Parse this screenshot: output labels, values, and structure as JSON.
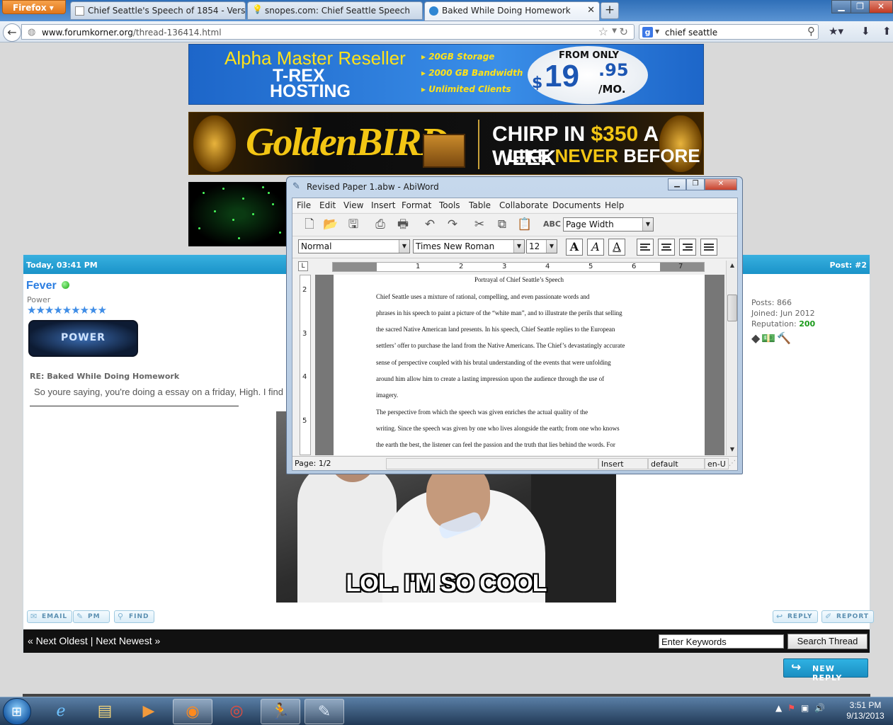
{
  "browser": {
    "menu_button": "Firefox",
    "tabs": [
      {
        "title": "Chief Seattle's Speech of 1854 - Versi..."
      },
      {
        "title": "snopes.com: Chief Seattle Speech"
      },
      {
        "title": "Baked While Doing Homework"
      }
    ],
    "url_domain": "www.forumkorner.org",
    "url_path": "/thread-136414.html",
    "search_query": "chief seattle"
  },
  "ads": {
    "hosting": {
      "line1": "Alpha Master Reseller",
      "line2": "T-REX",
      "line3": "HOSTING",
      "bullets": [
        "20GB Storage",
        "2000 GB Bandwidth",
        "Unlimited Clients"
      ],
      "from": "FROM ONLY",
      "dollar": "$",
      "price": "19",
      "cents": ".95",
      "per": "/MO."
    },
    "goldbird": {
      "logo": "GoldenBIRD",
      "line1_a": "CHIRP IN ",
      "line1_b": "$350",
      "line1_c": " A WEEK",
      "line2_a": "LIKE ",
      "line2_b": "NEVER",
      "line2_c": " BEFORE"
    }
  },
  "post": {
    "date": "Today, 03:41 PM",
    "number": "Post: #2",
    "username": "Fever",
    "user_title": "Power",
    "stars": "★★★★★★★★★",
    "badge_text": "POWER",
    "reply_title": "RE: Baked While Doing Homework",
    "message": "So youre saying, you're doing a essay on a friday, High. I find",
    "stats": {
      "posts": "Posts: 866",
      "joined": "Joined: Jun 2012",
      "reputation_label": "Reputation: ",
      "reputation_value": "200"
    },
    "buttons": {
      "email": "EMAIL",
      "pm": "PM",
      "find": "FIND",
      "reply": "REPLY",
      "report": "REPORT"
    },
    "meme_caption": "LOL. I'M SO COOL"
  },
  "thread_footer": {
    "nav": "« Next Oldest | Next Newest »",
    "keywords_placeholder": "Enter Keywords",
    "search_button": "Search Thread",
    "new_reply": "NEW REPLY"
  },
  "abiword": {
    "title": "Revised Paper 1.abw - AbiWord",
    "menu": [
      "File",
      "Edit",
      "View",
      "Insert",
      "Format",
      "Tools",
      "Table",
      "Collaborate",
      "Documents",
      "Help"
    ],
    "zoom": "Page Width",
    "style": "Normal",
    "font": "Times New Roman",
    "size": "12",
    "ruler_numbers": [
      "1",
      "2",
      "3",
      "4",
      "5",
      "6",
      "7"
    ],
    "vruler_numbers": [
      "2",
      "3",
      "4",
      "5"
    ],
    "document": {
      "title": "Portrayal of Chief Seattle’s Speech",
      "lines": [
        "        Chief Seattle uses a mixture of rational, compelling, and even passionate words and",
        "phrases in his speech to paint a picture of the “white man”, and to illustrate the perils that selling",
        "the sacred Native American land presents. In his speech, Chief Seattle replies to the European",
        "settlers’ offer to purchase the land from the Native Americans. The Chief’s devastatingly accurate",
        "sense of perspective coupled with his brutal understanding of the events that were unfolding",
        "around him allow him to create a lasting impression upon the audience through the use of",
        "imagery.",
        "        The perspective from which the speech was given enriches the actual quality of the",
        "writing. Since the speech was given by one who lives alongside the earth; from one who knows",
        "the earth the best, the listener can feel the passion and the truth that lies behind the words. For"
      ]
    },
    "status": {
      "page": "Page: 1/2",
      "mode": "Insert",
      "style": "default",
      "lang": "en-U"
    }
  },
  "taskbar": {
    "time": "3:51 PM",
    "date": "9/13/2013"
  },
  "colors": {
    "post_header": "#1a93c9",
    "username": "#2a7de1",
    "reputation": "#1a9a1a"
  }
}
